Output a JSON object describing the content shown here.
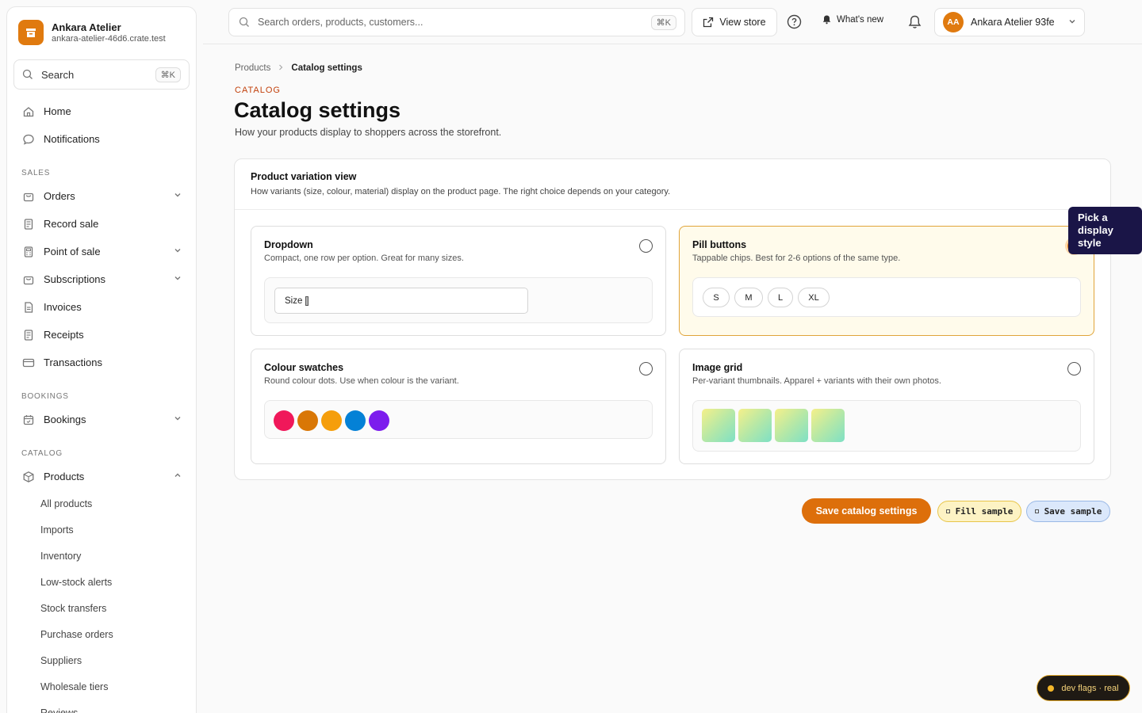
{
  "brand": {
    "name": "Ankara Atelier",
    "domain": "ankara-atelier-46d6.crate.test"
  },
  "sidebar": {
    "search_label": "Search",
    "search_shortcut": "⌘K",
    "top_items": [
      {
        "label": "Home",
        "icon": "home-icon"
      },
      {
        "label": "Notifications",
        "icon": "chat-bubble-icon"
      }
    ],
    "sections": [
      {
        "label": "SALES",
        "items": [
          {
            "label": "Orders",
            "icon": "bag-icon",
            "chevron": "down"
          },
          {
            "label": "Record sale",
            "icon": "receipt-icon"
          },
          {
            "label": "Point of sale",
            "icon": "calculator-icon",
            "chevron": "down"
          },
          {
            "label": "Subscriptions",
            "icon": "bag-icon",
            "chevron": "down"
          },
          {
            "label": "Invoices",
            "icon": "document-icon"
          },
          {
            "label": "Receipts",
            "icon": "receipt-icon"
          },
          {
            "label": "Transactions",
            "icon": "card-icon"
          }
        ]
      },
      {
        "label": "BOOKINGS",
        "items": [
          {
            "label": "Bookings",
            "icon": "calendar-icon",
            "chevron": "down"
          }
        ]
      },
      {
        "label": "CATALOG",
        "items": [
          {
            "label": "Products",
            "icon": "box-icon",
            "chevron": "up"
          }
        ]
      }
    ],
    "product_subitems": [
      "All products",
      "Imports",
      "Inventory",
      "Low-stock alerts",
      "Stock transfers",
      "Purchase orders",
      "Suppliers",
      "Wholesale tiers",
      "Reviews"
    ]
  },
  "topbar": {
    "search_placeholder": "Search orders, products, customers...",
    "search_shortcut": "⌘K",
    "view_store": "View store",
    "whats_new": "What's new",
    "avatar_initials": "AA",
    "account_name": "Ankara Atelier 93fe"
  },
  "breadcrumb": {
    "parent": "Products",
    "current": "Catalog settings"
  },
  "page": {
    "eyebrow": "CATALOG",
    "title": "Catalog settings",
    "subtitle": "How your products display to shoppers across the storefront."
  },
  "variation_card": {
    "title": "Product variation view",
    "description": "How variants (size, colour, material) display on the product page. The right choice depends on your category.",
    "selected": "pill_buttons",
    "options": {
      "dropdown": {
        "title": "Dropdown",
        "description": "Compact, one row per option. Great for many sizes.",
        "select_value": "Size"
      },
      "pill_buttons": {
        "title": "Pill buttons",
        "description": "Tappable chips. Best for 2-6 options of the same type.",
        "pills": [
          "S",
          "M",
          "L",
          "XL"
        ]
      },
      "colour_swatches": {
        "title": "Colour swatches",
        "description": "Round colour dots. Use when colour is the variant.",
        "colors": [
          "#f0185a",
          "#d97706",
          "#f59e0b",
          "#0481d6",
          "#7c1ded"
        ]
      },
      "image_grid": {
        "title": "Image grid",
        "description": "Per-variant thumbnails. Apparel + variants with their own photos.",
        "thumb_count": 4
      }
    }
  },
  "tooltip": "Pick a display style",
  "actions": {
    "save": "Save catalog settings",
    "fill_sample": "Fill sample",
    "save_sample": "Save sample"
  },
  "dev_flags": "dev flags · real",
  "colors": {
    "accent": "#dd6f0b",
    "selected_bg": "#fffbeb",
    "tooltip_bg": "#1a1547"
  }
}
